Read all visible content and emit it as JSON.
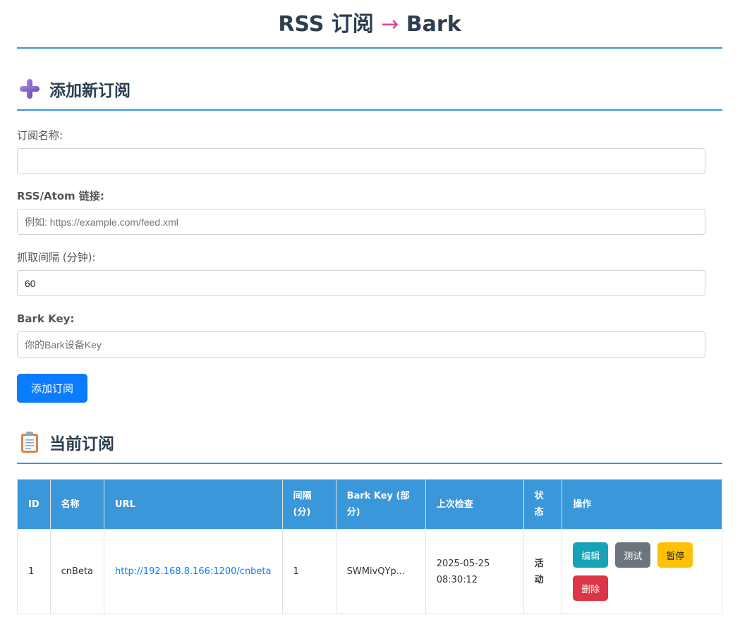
{
  "header": {
    "title_left": "RSS 订阅",
    "title_arrow": "→",
    "title_right": "Bark"
  },
  "add_section": {
    "heading": "添加新订阅",
    "icon": "plus-icon",
    "fields": {
      "name": {
        "label": "订阅名称:",
        "value": "",
        "placeholder": ""
      },
      "url": {
        "label": "RSS/Atom 链接:",
        "value": "",
        "placeholder": "例如: https://example.com/feed.xml"
      },
      "interval": {
        "label": "抓取间隔 (分钟):",
        "value": "60",
        "placeholder": ""
      },
      "bark_key": {
        "label": "Bark Key:",
        "value": "",
        "placeholder": "你的Bark设备Key"
      }
    },
    "submit_label": "添加订阅"
  },
  "list_section": {
    "heading": "当前订阅",
    "icon": "clipboard-icon",
    "columns": [
      "ID",
      "名称",
      "URL",
      "间隔 (分)",
      "Bark Key (部分)",
      "上次检查",
      "状态",
      "操作"
    ],
    "rows": [
      {
        "id": "1",
        "name": "cnBeta",
        "url": "http://192.168.8.166:1200/cnbeta",
        "interval": "1",
        "bark_key": "SWMivQYp...",
        "last_check": "2025-05-25 08:30:12",
        "status": "活动",
        "actions": {
          "edit": "编辑",
          "test": "测试",
          "pause": "暂停",
          "delete": "删除"
        }
      }
    ]
  },
  "colors": {
    "accent": "#3a97d9",
    "primary": "#0a7cff",
    "arrow": "#e83e8c",
    "status_active": "#28a745"
  }
}
